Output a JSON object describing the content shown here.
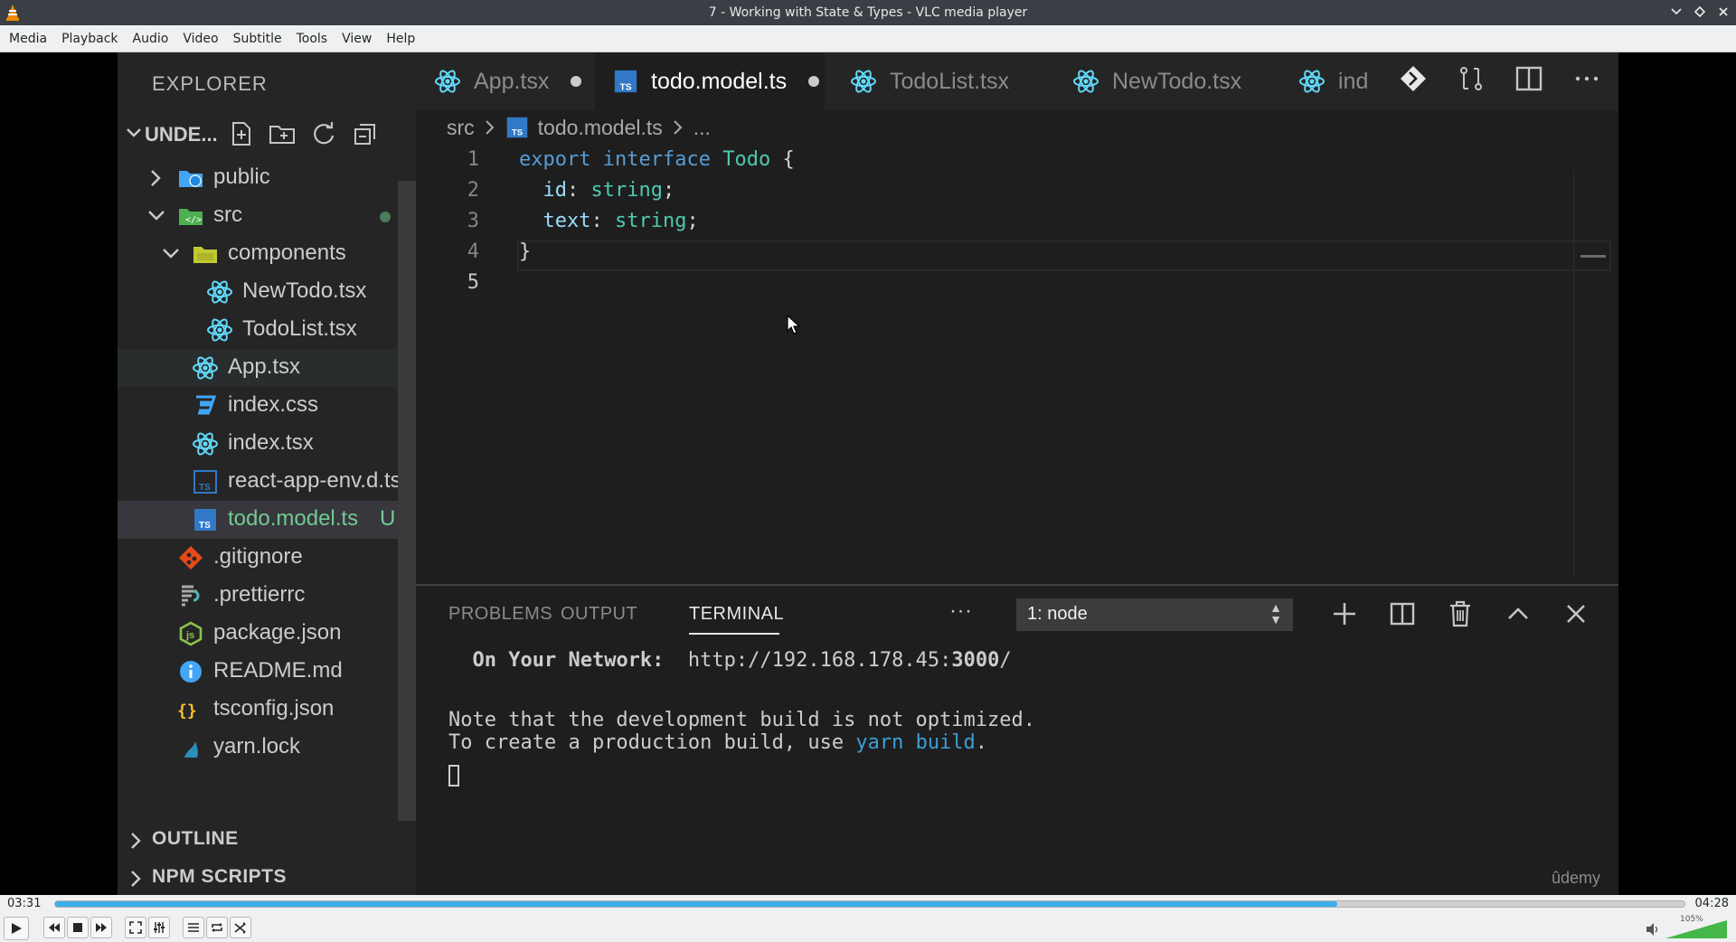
{
  "window": {
    "title": "7 - Working with State & Types - VLC media player"
  },
  "menu": [
    "Media",
    "Playback",
    "Audio",
    "Video",
    "Subtitle",
    "Tools",
    "View",
    "Help"
  ],
  "vscode": {
    "explorer_title": "EXPLORER",
    "project_name": "UNDE...",
    "tree": [
      {
        "label": "public",
        "icon": "public-folder-icon",
        "color": "#cccccc"
      },
      {
        "label": "src",
        "icon": "src-folder-icon",
        "color": "#cccccc"
      },
      {
        "label": "components",
        "icon": "folder-icon",
        "color": "#cccccc"
      },
      {
        "label": "NewTodo.tsx",
        "icon": "react-icon",
        "color": "#cccccc"
      },
      {
        "label": "TodoList.tsx",
        "icon": "react-icon",
        "color": "#cccccc"
      },
      {
        "label": "App.tsx",
        "icon": "react-icon",
        "color": "#cccccc"
      },
      {
        "label": "index.css",
        "icon": "css-icon",
        "color": "#cccccc"
      },
      {
        "label": "index.tsx",
        "icon": "react-icon",
        "color": "#cccccc"
      },
      {
        "label": "react-app-env.d.ts",
        "icon": "ts-icon",
        "color": "#cccccc"
      },
      {
        "label": "todo.model.ts",
        "icon": "ts-icon",
        "color": "#73c991",
        "badge": "U"
      },
      {
        "label": ".gitignore",
        "icon": "git-icon",
        "color": "#cccccc"
      },
      {
        "label": ".prettierrc",
        "icon": "prettier-icon",
        "color": "#cccccc"
      },
      {
        "label": "package.json",
        "icon": "npm-icon",
        "color": "#cccccc"
      },
      {
        "label": "README.md",
        "icon": "info-icon",
        "color": "#cccccc"
      },
      {
        "label": "tsconfig.json",
        "icon": "json-icon",
        "color": "#cccccc"
      },
      {
        "label": "yarn.lock",
        "icon": "yarn-icon",
        "color": "#cccccc"
      }
    ],
    "sections": [
      "OUTLINE",
      "NPM SCRIPTS"
    ],
    "tabs": [
      {
        "label": "App.tsx",
        "dirty": true,
        "active": false
      },
      {
        "label": "todo.model.ts",
        "dirty": true,
        "active": true
      },
      {
        "label": "TodoList.tsx",
        "dirty": false,
        "active": false
      },
      {
        "label": "NewTodo.tsx",
        "dirty": false,
        "active": false
      },
      {
        "label": "ind",
        "dirty": false,
        "active": false
      }
    ],
    "breadcrumb": {
      "folder": "src",
      "file": "todo.model.ts",
      "more": "..."
    },
    "code": {
      "line_numbers": [
        "1",
        "2",
        "3",
        "4",
        "5"
      ],
      "line1": {
        "kw1": "export",
        "kw2": "interface",
        "type": "Todo",
        "brace": "{"
      },
      "line2": {
        "prop": "id",
        "colon": ":",
        "type": "string",
        "semi": ";"
      },
      "line3": {
        "prop": "text",
        "colon": ":",
        "type": "string",
        "semi": ";"
      },
      "line4": {
        "brace": "}"
      }
    },
    "panel": {
      "tabs": [
        "PROBLEMS",
        "OUTPUT",
        "TERMINAL"
      ],
      "more": "···",
      "terminal_select": "1: node",
      "terminal": {
        "network_label": "On Your Network:",
        "network_url_prefix": "http://192.168.178.45:",
        "network_port": "3000",
        "network_url_suffix": "/",
        "note1": "Note that the development build is not optimized.",
        "note2_prefix": "To create a production build, use ",
        "note2_cmd": "yarn build",
        "note2_suffix": "."
      }
    },
    "watermark": "ûdemy"
  },
  "player": {
    "elapsed": "03:31",
    "total": "04:28",
    "progress_fraction": 0.787,
    "volume_label": "105%",
    "volume_fraction": 1.05,
    "accent_color": "#3daee9"
  }
}
